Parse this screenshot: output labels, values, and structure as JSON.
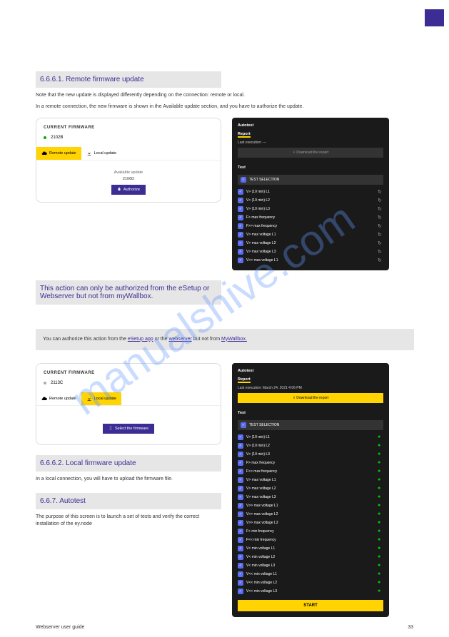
{
  "header": {
    "box": ""
  },
  "sections": {
    "remote_title": "6.6.6.1. Remote firmware update",
    "remote_body1": "Note that the new update is displayed differently depending on the connection: remote or local.",
    "remote_body2": "In a remote connection, the new firmware is shown in the Available update section, and you have to authorize the update.",
    "after_img1": "This action can only be authorized from the eSetup or Webserver but not from myWallbox.",
    "note_html_prefix": "You can authorize this action from the ",
    "note_link1": "eSetup app",
    "note_mid": " or the ",
    "note_link2": "webserver",
    "note_suffix": " but not from ",
    "note_link3": "MyWallbox.",
    "local_title": "6.6.6.2. Local firmware update",
    "local_body1": "In a local connection, you will have to upload the firmware file.",
    "autotest_title": "6.6.7. Autotest",
    "autotest_body": "The purpose of this screen is to launch a set of tests and verify the correct installation of the ey.node"
  },
  "firmware1": {
    "title": "CURRENT FIRMWARE",
    "version": "2102B",
    "tab_remote": "Remote update",
    "tab_local": "Local update",
    "avail": "Available update",
    "avail_v": "2106D",
    "btn": "Authorize"
  },
  "firmware2": {
    "title": "CURRENT FIRMWARE",
    "version": "2113C",
    "tab_remote": "Remote update",
    "tab_local": "Local update",
    "btn": "Select the firmware"
  },
  "autotest1": {
    "title": "Autotest",
    "report": "Report",
    "exec": "Last execution: ---",
    "download": "Download the report",
    "test": "Test",
    "th": "TEST SELECTION",
    "rows": [
      "V> (10 min) L1",
      "V> (10 min) L2",
      "V> (10 min) L3",
      "F> max frequency",
      "F>> max frequency",
      "V> max voltage L1",
      "V> max voltage L2",
      "V> max voltage L3",
      "V>> max voltage L1"
    ]
  },
  "autotest2": {
    "title": "Autotest",
    "report": "Report",
    "exec": "Last execution: March 24, 2021 4:06 PM",
    "download": "Download the report",
    "test": "Test",
    "th": "TEST SELECTION",
    "rows": [
      "V> (10 min) L1",
      "V> (10 min) L2",
      "V> (10 min) L3",
      "F> max frequency",
      "F>> max frequency",
      "V> max voltage L1",
      "V> max voltage L2",
      "V> max voltage L3",
      "V>> max voltage L1",
      "V>> max voltage L2",
      "V>> max voltage L3",
      "F< min frequency",
      "F<< min frequency",
      "V< min voltage L1",
      "V< min voltage L2",
      "V< min voltage L3",
      "V<< min voltage L1",
      "V<< min voltage L2",
      "V<< min voltage L3"
    ],
    "start": "START"
  },
  "footer": {
    "left": "Webserver user guide",
    "right": "33"
  },
  "watermark": "manualshive.com"
}
